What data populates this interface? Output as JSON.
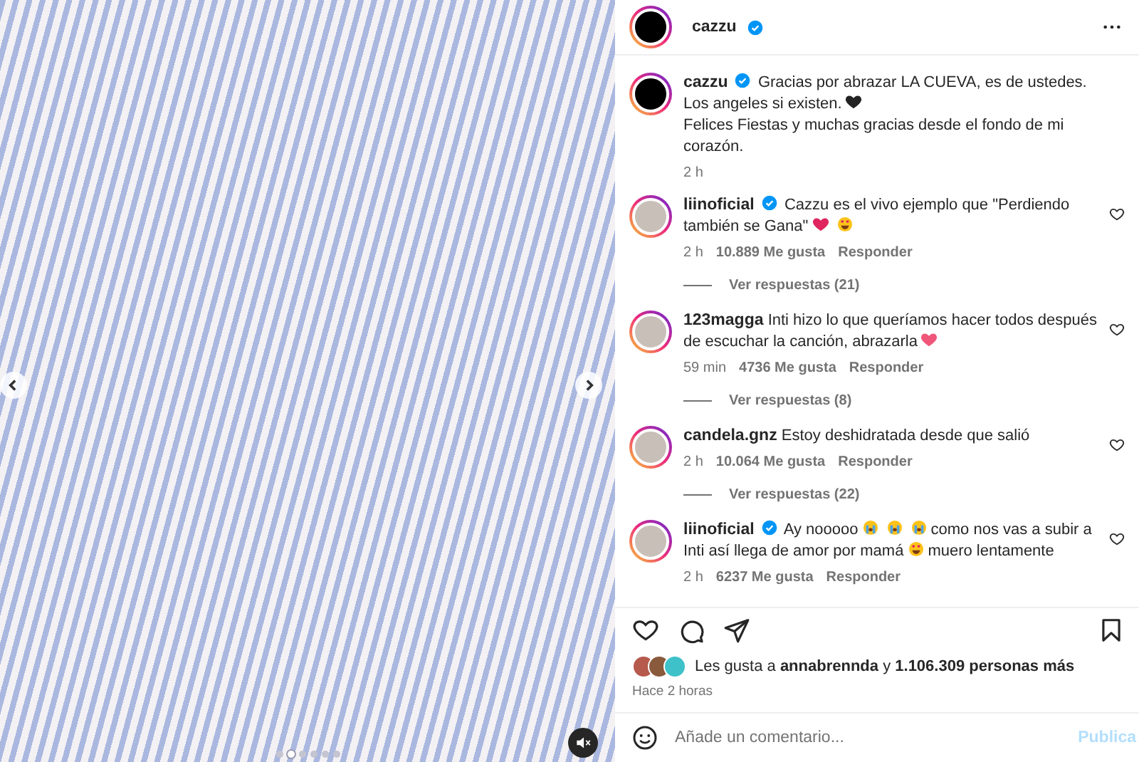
{
  "media": {
    "dots": [
      {
        "selected": false
      },
      {
        "selected": true
      },
      {
        "selected": false
      },
      {
        "selected": false
      },
      {
        "selected": false
      },
      {
        "selected": false
      }
    ]
  },
  "header": {
    "username": "cazzu",
    "verified": true
  },
  "caption": {
    "username": "cazzu",
    "verified": true,
    "parts": [
      {
        "kind": "text",
        "text": "Gracias por abrazar LA CUEVA, es de ustedes.\nLos angeles si existen."
      },
      {
        "kind": "blackheart"
      },
      {
        "kind": "text",
        "text": "\nFelices Fiestas y muchas gracias desde el fondo de mi corazón."
      }
    ],
    "time": "2 h"
  },
  "comments": [
    {
      "username": "liinoficial",
      "verified": true,
      "parts": [
        {
          "kind": "text",
          "text": "Cazzu es el vivo ejemplo que \"Perdiendo también se Gana\""
        },
        {
          "kind": "redheart"
        },
        {
          "kind": "hearteyes"
        }
      ],
      "time": "2 h",
      "likes": "10.889 Me gusta",
      "reply": "Responder",
      "replies": "Ver respuestas (21)"
    },
    {
      "username": "123magga",
      "verified": false,
      "parts": [
        {
          "kind": "text",
          "text": "Inti hizo lo que queríamos hacer todos después de escuchar la canción, abrazarla"
        },
        {
          "kind": "pinkheart"
        }
      ],
      "time": "59 min",
      "likes": "4736 Me gusta",
      "reply": "Responder",
      "replies": "Ver respuestas (8)"
    },
    {
      "username": "candela.gnz",
      "verified": false,
      "parts": [
        {
          "kind": "text",
          "text": "Estoy deshidratada desde que salió"
        }
      ],
      "time": "2 h",
      "likes": "10.064 Me gusta",
      "reply": "Responder",
      "replies": "Ver respuestas (22)"
    },
    {
      "username": "liinoficial",
      "verified": true,
      "parts": [
        {
          "kind": "text",
          "text": "Ay nooooo"
        },
        {
          "kind": "crying"
        },
        {
          "kind": "crying"
        },
        {
          "kind": "crying"
        },
        {
          "kind": "text",
          "text": "como nos vas a subir a Inti así llega de amor por mamá"
        },
        {
          "kind": "hearteyes"
        },
        {
          "kind": "text",
          "text": "muero lentamente"
        }
      ],
      "time": "2 h",
      "likes": "6237 Me gusta",
      "reply": "Responder"
    }
  ],
  "likes": "Les gusta a **annabrennda** y **1.106.309 personas más**",
  "posted": "Hace 2 horas",
  "composer": {
    "placeholder": "Añade un comentario...",
    "submit": "Publica"
  }
}
